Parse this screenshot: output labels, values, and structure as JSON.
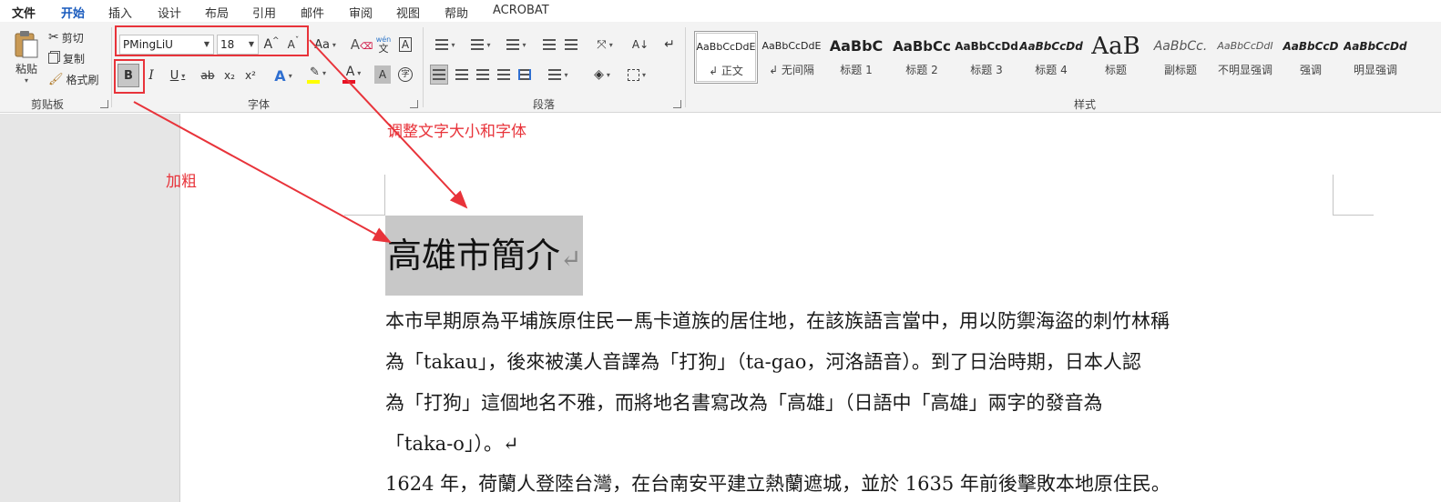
{
  "menu": {
    "tabs": [
      "文件",
      "开始",
      "插入",
      "设计",
      "布局",
      "引用",
      "邮件",
      "审阅",
      "视图",
      "帮助",
      "ACROBAT"
    ],
    "active": "开始"
  },
  "clipboard": {
    "paste": "粘贴",
    "cut": "剪切",
    "copy": "复制",
    "format_painter": "格式刷",
    "label": "剪贴板"
  },
  "font": {
    "name": "PMingLiU",
    "size": "18",
    "grow": "A",
    "shrink": "A",
    "change_case": "Aa",
    "phonetic_top": "wén",
    "phonetic_bottom": "文",
    "bold": "B",
    "italic": "I",
    "underline": "U",
    "strikethrough": "ab",
    "subscript": "x₂",
    "superscript": "x²",
    "text_effects": "A",
    "font_color": "A",
    "char_shading": "A",
    "enclose": "字",
    "label": "字体",
    "font_color_hex": "#e81123",
    "highlight_hex": "#ffff00"
  },
  "paragraph": {
    "label": "段落"
  },
  "styles": {
    "label": "样式",
    "items": [
      {
        "preview": "AaBbCcDdE",
        "name": "↲ 正文",
        "selected": true
      },
      {
        "preview": "AaBbCcDdE",
        "name": "↲ 无间隔"
      },
      {
        "preview": "AaBbC",
        "name": "标题 1"
      },
      {
        "preview": "AaBbCc",
        "name": "标题 2"
      },
      {
        "preview": "AaBbCcDd",
        "name": "标题 3"
      },
      {
        "preview": "AaBbCcDd",
        "name": "标题 4"
      },
      {
        "preview": "AaB",
        "name": "标题"
      },
      {
        "preview": "AaBbCc.",
        "name": "副标题"
      },
      {
        "preview": "AaBbCcDdI",
        "name": "不明显强调"
      },
      {
        "preview": "AaBbCcD",
        "name": "强调"
      },
      {
        "preview": "AaBbCcDdE",
        "name": "明显强调"
      }
    ]
  },
  "annotations": {
    "font_hint": "调整文字大小和字体",
    "bold_hint": "加粗",
    "color": "#e8333a"
  },
  "document": {
    "title": "高雄市簡介",
    "paragraph_mark": "↵",
    "lines": [
      "本市早期原為平埔族原住民ー馬卡道族的居住地，在該族語言當中，用以防禦海盜的刺竹林稱",
      "為「takau」，後來被漢人音譯為「打狗」（ta-gao，河洛語音）。到了日治時期，日本人認",
      "為「打狗」這個地名不雅，而將地名書寫改為「高雄」（日語中「高雄」兩字的發音為",
      "「taka-o」）。↵",
      "1624 年，荷蘭人登陸台灣，在台南安平建立熱蘭遮城，並於 1635 年前後擊敗本地原住民。"
    ]
  }
}
